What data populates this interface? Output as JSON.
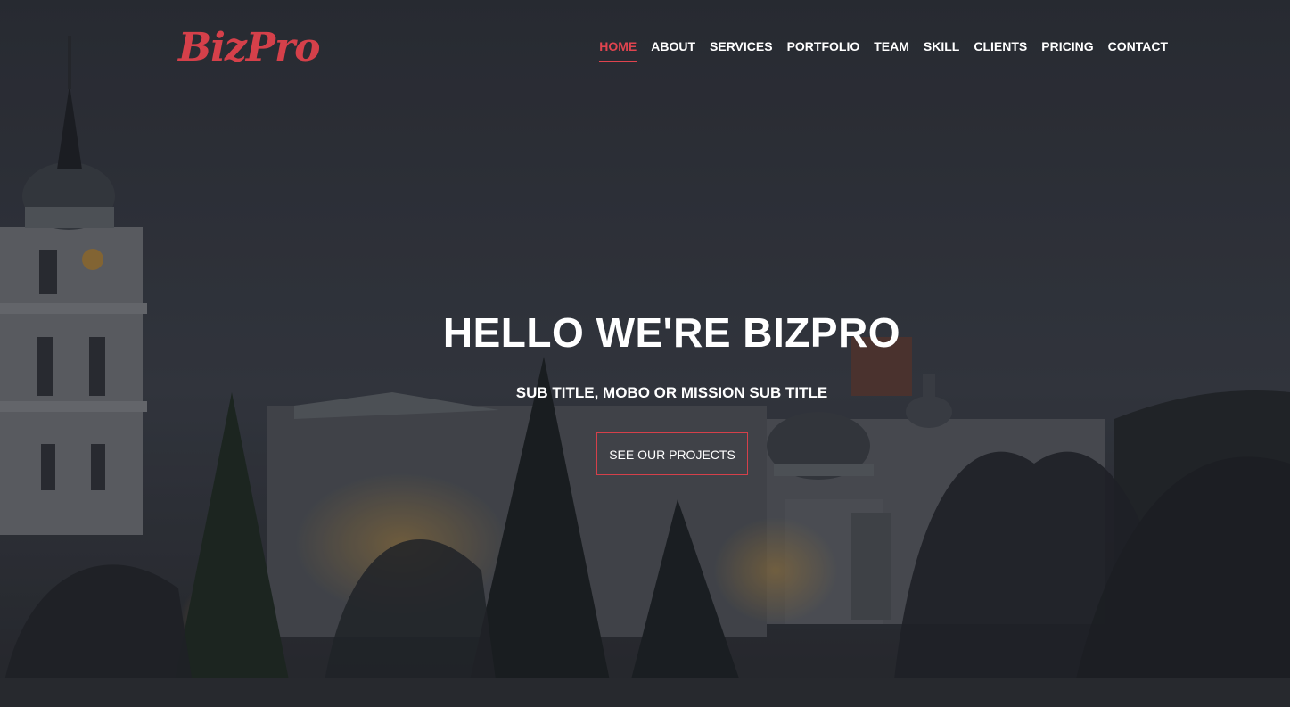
{
  "brand": {
    "logo_text": "BizPro",
    "accent_color": "#d5404a"
  },
  "nav": {
    "items": [
      {
        "label": "HOME",
        "active": true
      },
      {
        "label": "ABOUT",
        "active": false
      },
      {
        "label": "SERVICES",
        "active": false
      },
      {
        "label": "PORTFOLIO",
        "active": false
      },
      {
        "label": "TEAM",
        "active": false
      },
      {
        "label": "SKILL",
        "active": false
      },
      {
        "label": "CLIENTS",
        "active": false
      },
      {
        "label": "PRICING",
        "active": false
      },
      {
        "label": "CONTACT",
        "active": false
      }
    ]
  },
  "hero": {
    "title": "HELLO WE'RE BIZPRO",
    "subtitle": "SUB TITLE, MOBO OR MISSION SUB TITLE",
    "cta_label": "SEE OUR PROJECTS",
    "background": "night-city-cathedral-photo"
  }
}
